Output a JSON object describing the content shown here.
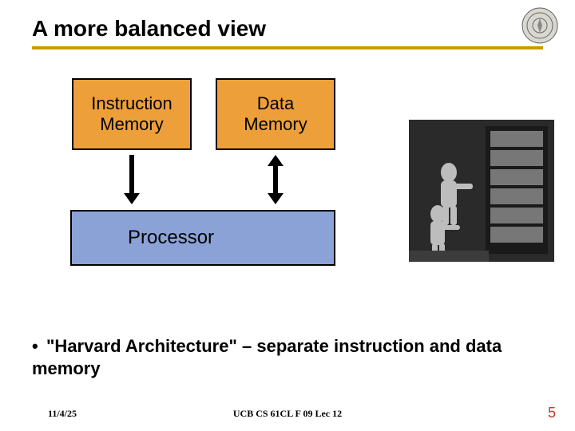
{
  "title": "A more balanced view",
  "diagram": {
    "instruction_memory": "Instruction\nMemory",
    "data_memory": "Data\nMemory",
    "processor": "Processor"
  },
  "bullet": {
    "marker": "•",
    "text": "\"Harvard Architecture\" – separate instruction and data memory"
  },
  "footer": {
    "date": "11/4/25",
    "course": "UCB CS 61CL F 09 Lec 12",
    "page": "5"
  },
  "icons": {
    "seal": "university-seal-icon",
    "photo": "eniac-photo-placeholder"
  }
}
